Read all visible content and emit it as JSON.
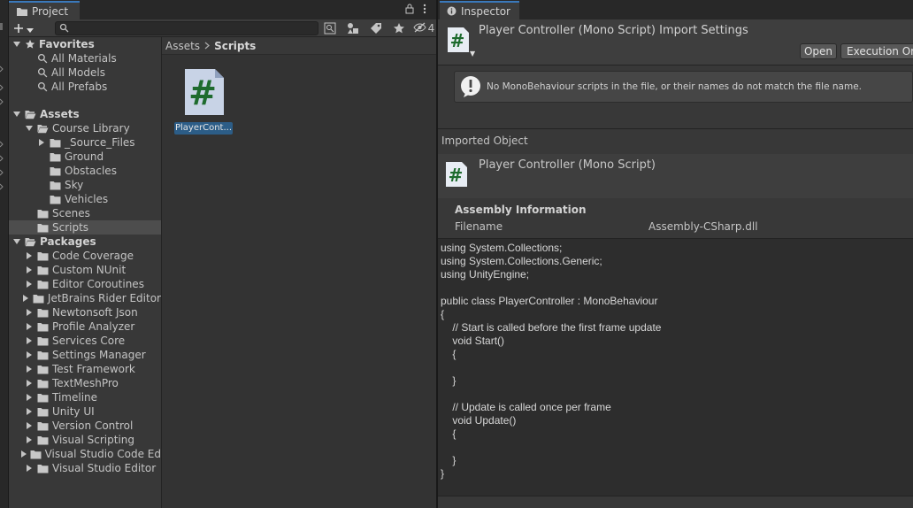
{
  "project": {
    "tab_label": "Project",
    "hidden_count": "4",
    "tree": [
      {
        "label": "Favorites",
        "bold": true,
        "expanded": true,
        "level": 0,
        "icon": "star-icon"
      },
      {
        "label": "All Materials",
        "level": 1,
        "icon": "search-icon"
      },
      {
        "label": "All Models",
        "level": 1,
        "icon": "search-icon"
      },
      {
        "label": "All Prefabs",
        "level": 1,
        "icon": "search-icon"
      },
      {
        "label": "",
        "level": -1
      },
      {
        "label": "Assets",
        "bold": true,
        "expanded": true,
        "level": 0,
        "icon": "folder-open-icon"
      },
      {
        "label": "Course Library",
        "expanded": true,
        "level": 1,
        "icon": "folder-open-icon"
      },
      {
        "label": "_Source_Files",
        "collapsed": true,
        "level": 2,
        "icon": "folder-icon"
      },
      {
        "label": "Ground",
        "level": 2,
        "icon": "folder-icon"
      },
      {
        "label": "Obstacles",
        "level": 2,
        "icon": "folder-icon"
      },
      {
        "label": "Sky",
        "level": 2,
        "icon": "folder-icon"
      },
      {
        "label": "Vehicles",
        "level": 2,
        "icon": "folder-icon"
      },
      {
        "label": "Scenes",
        "level": 1,
        "icon": "folder-icon"
      },
      {
        "label": "Scripts",
        "level": 1,
        "icon": "folder-icon",
        "selected": true
      },
      {
        "label": "Packages",
        "bold": true,
        "expanded": true,
        "level": 0,
        "icon": "folder-open-icon"
      },
      {
        "label": "Code Coverage",
        "collapsed": true,
        "level": 1,
        "icon": "folder-icon"
      },
      {
        "label": "Custom NUnit",
        "collapsed": true,
        "level": 1,
        "icon": "folder-icon"
      },
      {
        "label": "Editor Coroutines",
        "collapsed": true,
        "level": 1,
        "icon": "folder-icon"
      },
      {
        "label": "JetBrains Rider Editor",
        "collapsed": true,
        "level": 1,
        "icon": "folder-icon"
      },
      {
        "label": "Newtonsoft Json",
        "collapsed": true,
        "level": 1,
        "icon": "folder-icon"
      },
      {
        "label": "Profile Analyzer",
        "collapsed": true,
        "level": 1,
        "icon": "folder-icon"
      },
      {
        "label": "Services Core",
        "collapsed": true,
        "level": 1,
        "icon": "folder-icon"
      },
      {
        "label": "Settings Manager",
        "collapsed": true,
        "level": 1,
        "icon": "folder-icon"
      },
      {
        "label": "Test Framework",
        "collapsed": true,
        "level": 1,
        "icon": "folder-icon"
      },
      {
        "label": "TextMeshPro",
        "collapsed": true,
        "level": 1,
        "icon": "folder-icon"
      },
      {
        "label": "Timeline",
        "collapsed": true,
        "level": 1,
        "icon": "folder-icon"
      },
      {
        "label": "Unity UI",
        "collapsed": true,
        "level": 1,
        "icon": "folder-icon"
      },
      {
        "label": "Version Control",
        "collapsed": true,
        "level": 1,
        "icon": "folder-icon"
      },
      {
        "label": "Visual Scripting",
        "collapsed": true,
        "level": 1,
        "icon": "folder-icon"
      },
      {
        "label": "Visual Studio Code Ed",
        "collapsed": true,
        "level": 1,
        "icon": "folder-icon"
      },
      {
        "label": "Visual Studio Editor",
        "collapsed": true,
        "level": 1,
        "icon": "folder-icon"
      }
    ],
    "breadcrumb": {
      "root": "Assets",
      "current": "Scripts"
    },
    "asset": {
      "label": "PlayerCont..."
    }
  },
  "inspector": {
    "tab_label": "Inspector",
    "title": "Player Controller (Mono Script) Import Settings",
    "open_label": "Open",
    "execution_label": "Execution Ord",
    "help_message": "No MonoBehaviour scripts in the file, or their names do not match the file name.",
    "imported_label": "Imported Object",
    "imported_name": "Player Controller (Mono Script)",
    "assembly_title": "Assembly Information",
    "filename_key": "Filename",
    "filename_value": "Assembly-CSharp.dll",
    "code": [
      "using System.Collections;",
      "using System.Collections.Generic;",
      "using UnityEngine;",
      "",
      "public class PlayerController : MonoBehaviour",
      "{",
      "    // Start is called before the first frame update",
      "    void Start()",
      "    {",
      "",
      "    }",
      "",
      "    // Update is called once per frame",
      "    void Update()",
      "    {",
      "",
      "    }",
      "}"
    ]
  },
  "colors": {
    "accent": "#3a79bb",
    "selection": "#2c5d87",
    "script_icon_green": "#1e6b2e"
  }
}
